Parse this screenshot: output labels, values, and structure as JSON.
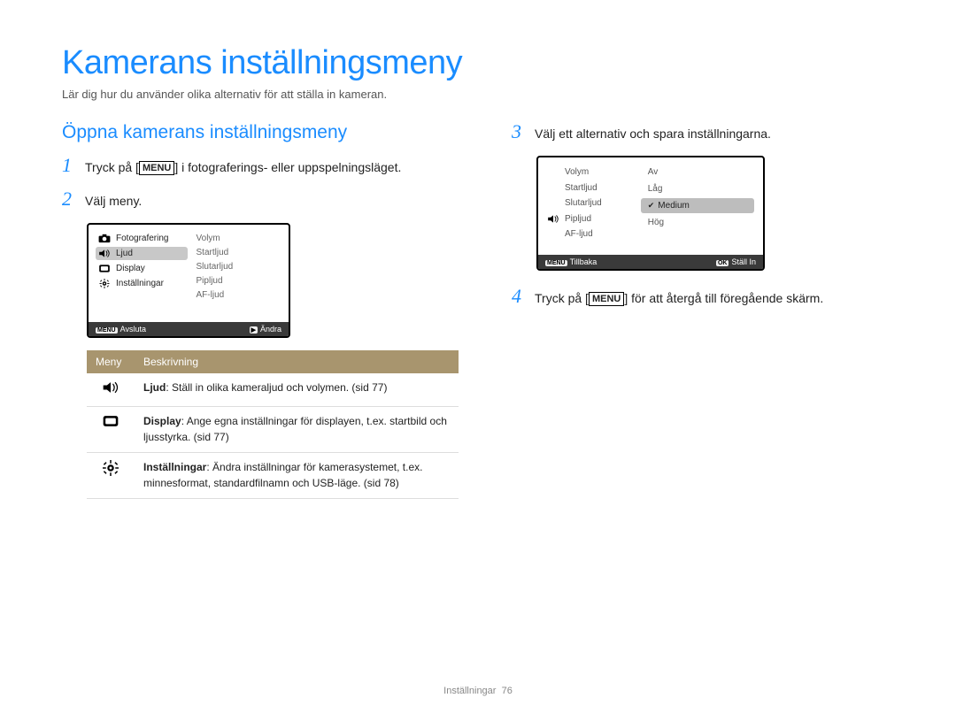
{
  "page": {
    "title": "Kamerans inställningsmeny",
    "subtitle": "Lär dig hur du använder olika alternativ för att ställa in kameran.",
    "footer_section": "Inställningar",
    "footer_page": "76"
  },
  "section": {
    "title": "Öppna kamerans inställningsmeny"
  },
  "steps": {
    "s1a": "Tryck på [",
    "s1menu": "MENU",
    "s1b": "] i fotograferings- eller uppspelningsläget.",
    "s2": "Välj meny.",
    "s3": "Välj ett alternativ och spara inställningarna.",
    "s4a": "Tryck på [",
    "s4menu": "MENU",
    "s4b": "] för att återgå till föregående skärm."
  },
  "screen1": {
    "left": [
      "Fotografering",
      "Ljud",
      "Display",
      "Inställningar"
    ],
    "right": [
      "Volym",
      "Startljud",
      "Slutarljud",
      "Pipljud",
      "AF-ljud"
    ],
    "footer_left_key": "MENU",
    "footer_left": "Avsluta",
    "footer_right_key": "▶",
    "footer_right": "Ändra"
  },
  "table": {
    "h1": "Meny",
    "h2": "Beskrivning",
    "rows": [
      {
        "icon": "sound",
        "bold": "Ljud",
        "text": ": Ställ in olika kameraljud och volymen. (sid 77)"
      },
      {
        "icon": "display",
        "bold": "Display",
        "text": ": Ange egna inställningar för displayen, t.ex. startbild och ljusstyrka. (sid 77)"
      },
      {
        "icon": "gear",
        "bold": "Inställningar",
        "text": ": Ändra inställningar för kamerasystemet, t.ex. minnesformat, standardfilnamn och USB-läge. (sid 78)"
      }
    ]
  },
  "screen2": {
    "left": [
      "Volym",
      "Startljud",
      "Slutarljud",
      "Pipljud",
      "AF-ljud"
    ],
    "right": [
      "Av",
      "Låg",
      "Medium",
      "Hög"
    ],
    "selected": "Medium",
    "footer_left_key": "MENU",
    "footer_left": "Tillbaka",
    "footer_right_key": "OK",
    "footer_right": "Ställ In"
  }
}
